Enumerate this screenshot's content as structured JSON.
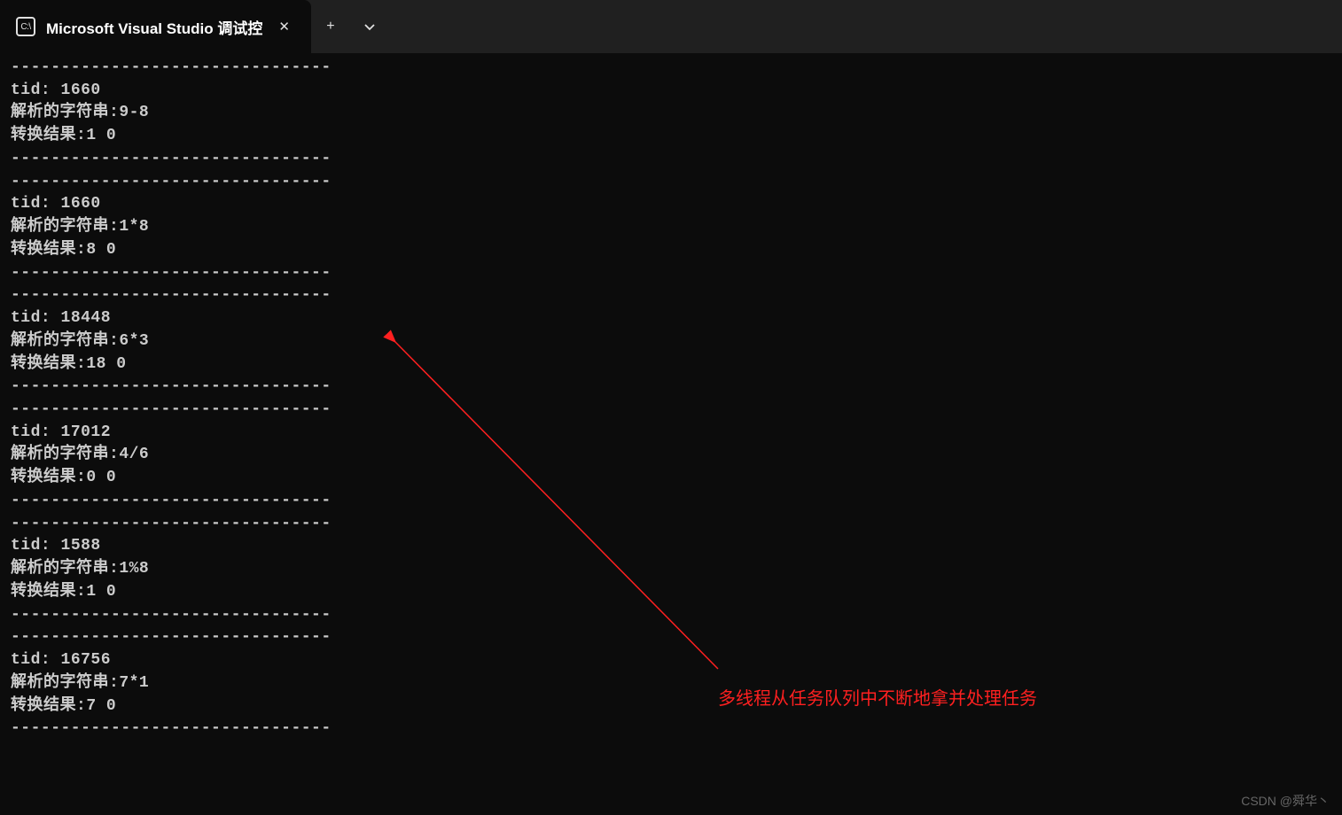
{
  "titlebar": {
    "tab_title": "Microsoft Visual Studio 调试控",
    "tab_icon_text": "C:\\",
    "new_tab_symbol": "+",
    "dropdown_symbol": "⌄"
  },
  "console_blocks": [
    {
      "divider_top": "--------------------------------",
      "tid_label": "tid:",
      "tid": "1660",
      "parse_label": "解析的字符串:",
      "parse_value": "9-8",
      "result_label": "转换结果:",
      "result_value": "1 0",
      "divider_bottom": "--------------------------------"
    },
    {
      "divider_top": "--------------------------------",
      "tid_label": "tid:",
      "tid": "1660",
      "parse_label": "解析的字符串:",
      "parse_value": "1*8",
      "result_label": "转换结果:",
      "result_value": "8 0",
      "divider_bottom": "--------------------------------"
    },
    {
      "divider_top": "--------------------------------",
      "tid_label": "tid:",
      "tid": "18448",
      "parse_label": "解析的字符串:",
      "parse_value": "6*3",
      "result_label": "转换结果:",
      "result_value": "18 0",
      "divider_bottom": "--------------------------------"
    },
    {
      "divider_top": "--------------------------------",
      "tid_label": "tid:",
      "tid": "17012",
      "parse_label": "解析的字符串:",
      "parse_value": "4/6",
      "result_label": "转换结果:",
      "result_value": "0 0",
      "divider_bottom": "--------------------------------"
    },
    {
      "divider_top": "--------------------------------",
      "tid_label": "tid:",
      "tid": "1588",
      "parse_label": "解析的字符串:",
      "parse_value": "1%8",
      "result_label": "转换结果:",
      "result_value": "1 0",
      "divider_bottom": "--------------------------------"
    },
    {
      "divider_top": "--------------------------------",
      "tid_label": "tid:",
      "tid": "16756",
      "parse_label": "解析的字符串:",
      "parse_value": "7*1",
      "result_label": "转换结果:",
      "result_value": "7 0",
      "divider_bottom": "--------------------------------"
    }
  ],
  "annotation": {
    "text": "多线程从任务队列中不断地拿并处理任务",
    "arrow_color": "#ff2020"
  },
  "watermark": "CSDN @舜华丶"
}
